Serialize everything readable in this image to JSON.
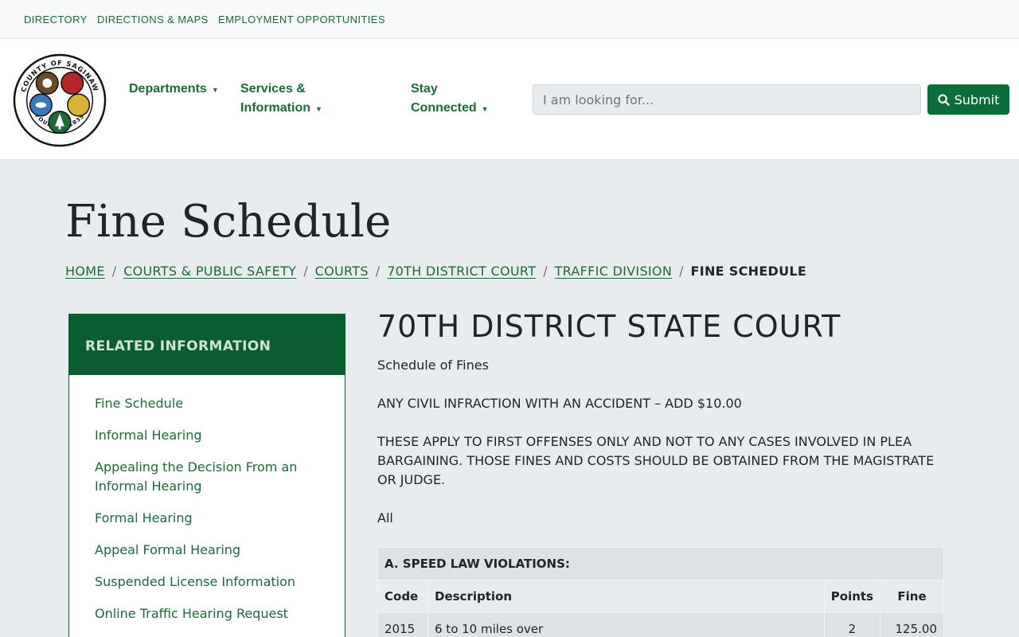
{
  "utility_nav": {
    "directory": "DIRECTORY",
    "directions": "DIRECTIONS & MAPS",
    "employment": "EMPLOYMENT OPPORTUNITIES"
  },
  "logo": {
    "top_text": "COUNTY OF SAGINAW",
    "bottom_text": "FOUNDED 1835"
  },
  "main_nav": {
    "departments": "Departments",
    "services_line1": "Services &",
    "services_line2": "Information",
    "stay_line1": "Stay",
    "stay_line2": "Connected"
  },
  "search": {
    "placeholder": "I am looking for...",
    "submit_label": "Submit"
  },
  "page": {
    "title": "Fine Schedule"
  },
  "breadcrumb": {
    "home": "HOME",
    "courts_safety": "COURTS & PUBLIC SAFETY",
    "courts": "COURTS",
    "district": "70TH DISTRICT COURT",
    "traffic": "TRAFFIC DIVISION",
    "current": "FINE SCHEDULE"
  },
  "sidebar": {
    "heading": "RELATED INFORMATION",
    "items": [
      "Fine Schedule",
      "Informal Hearing",
      "Appealing the Decision From an Informal Hearing",
      "Formal Hearing",
      "Appeal Formal Hearing",
      "Suspended License Information",
      "Online Traffic Hearing Request"
    ]
  },
  "content": {
    "heading": "70TH DISTRICT STATE COURT",
    "subtitle": "Schedule of Fines",
    "accident_note": "ANY CIVIL INFRACTION WITH AN ACCIDENT – ADD $10.00",
    "first_offense_note": "THESE APPLY TO FIRST OFFENSES ONLY AND NOT TO ANY CASES INVOLVED IN PLEA BARGAINING. THOSE FINES AND COSTS SHOULD BE OBTAINED FROM THE MAGISTRATE OR JUDGE.",
    "all_label": "All"
  },
  "table": {
    "section_title": "A. SPEED LAW VIOLATIONS:",
    "columns": [
      "Code",
      "Description",
      "Points",
      "Fine"
    ],
    "rows": [
      {
        "code": "2015",
        "description": "6 to 10 miles over",
        "points": "2",
        "fine": "125.00"
      }
    ]
  },
  "colors": {
    "brand_green": "#0a5c31",
    "link_green": "#1a6b34",
    "button_green": "#0b6e3a",
    "page_bg": "#e9ecef"
  }
}
